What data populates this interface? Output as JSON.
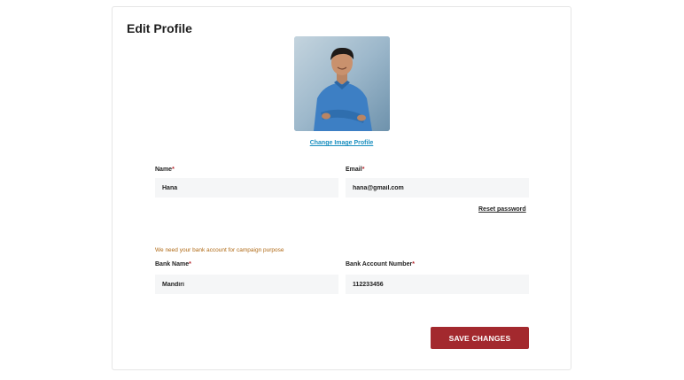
{
  "page": {
    "title": "Edit Profile",
    "change_image_label": "Change Image Profile",
    "reset_password_label": "Reset password",
    "bank_note": "We need your bank account for campaign purpose",
    "save_label": "SAVE CHANGES",
    "required_mark": "*"
  },
  "fields": {
    "name": {
      "label": "Name",
      "value": "Hana"
    },
    "email": {
      "label": "Email",
      "value": "hana@gmail.com"
    },
    "bank_name": {
      "label": "Bank Name",
      "value": "Mandiri"
    },
    "bank_account": {
      "label": "Bank Account Number",
      "value": "112233456"
    }
  },
  "colors": {
    "accent": "#a3292e",
    "link": "#1a8fbf",
    "note": "#b06a16",
    "required": "#b5252c"
  }
}
